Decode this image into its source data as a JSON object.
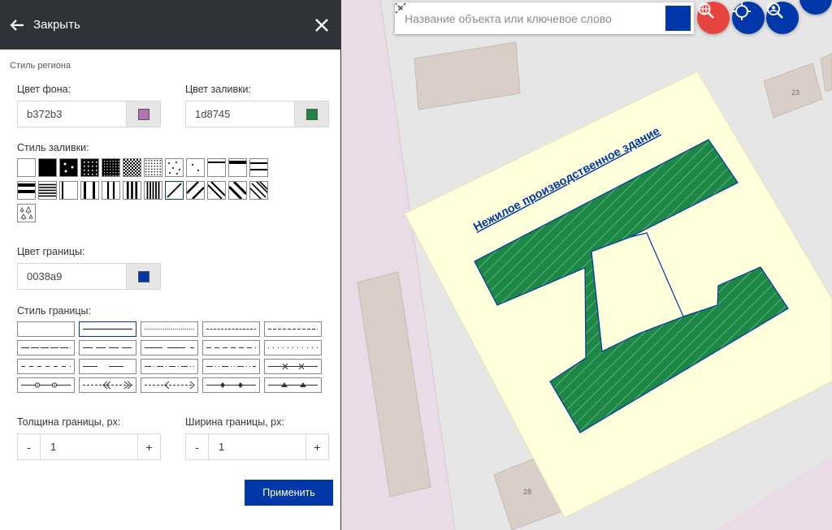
{
  "header": {
    "title": "Закрыть"
  },
  "panel": {
    "section_title": "Стиль региона",
    "bg_color_label": "Цвет фона:",
    "bg_color_value": "b372b3",
    "bg_swatch": "#b372b3",
    "fill_color_label": "Цвет заливки:",
    "fill_color_value": "1d8745",
    "fill_swatch": "#1d8745",
    "fill_style_label": "Стиль заливки:",
    "border_color_label": "Цвет границы:",
    "border_color_value": "0038a9",
    "border_swatch": "#0038a9",
    "border_style_label": "Стиль границы:",
    "thickness_label": "Толщина границы, px:",
    "thickness_value": "1",
    "width_label": "Ширина границы, px:",
    "width_value": "1",
    "minus_label": "-",
    "plus_label": "+",
    "apply_label": "Применить"
  },
  "fill_patterns": [
    [
      "empty",
      "solid",
      "dots-large",
      "dots-dense",
      "grid-dots",
      "checker",
      "dots-fine",
      "dots-sparse",
      "dots-two",
      "line-top",
      "line-top-thick",
      "line-mid"
    ],
    [
      "lines-h-thick",
      "lines-h",
      "line-left",
      "lines-v-2",
      "lines-v-3",
      "lines-v-4",
      "lines-v-dense",
      "diag-single",
      "diag-double",
      "diag-back",
      "diag-back-thick",
      "diag-dense"
    ],
    [
      "trees"
    ]
  ],
  "selected_fill_pattern": "diag-single",
  "border_patterns": [
    [
      "solid-thin",
      "solid",
      "dotted",
      "dashed-fine",
      "dashed"
    ],
    [
      "long-dash",
      "dash-gap",
      "long-dash-gap",
      "dash-medium",
      "dots-spaced"
    ],
    [
      "dash-short-spaced",
      "long-dash-wide",
      "dash-dot",
      "dash-dot-dot",
      "cross-line"
    ],
    [
      "circle-line",
      "double-arrow-left",
      "arrow-left",
      "diamond-line",
      "triangle-line"
    ]
  ],
  "selected_border_pattern": "solid",
  "search": {
    "placeholder": "Название объекта или ключевое слово"
  },
  "map": {
    "feature_label": "Нежилое производственное здание",
    "building_number_1": "23",
    "building_number_2": "28",
    "colors": {
      "fill": "#1d8745",
      "border": "#0038a9",
      "parcel": "#ffffdc",
      "road": "#eadce6"
    }
  }
}
